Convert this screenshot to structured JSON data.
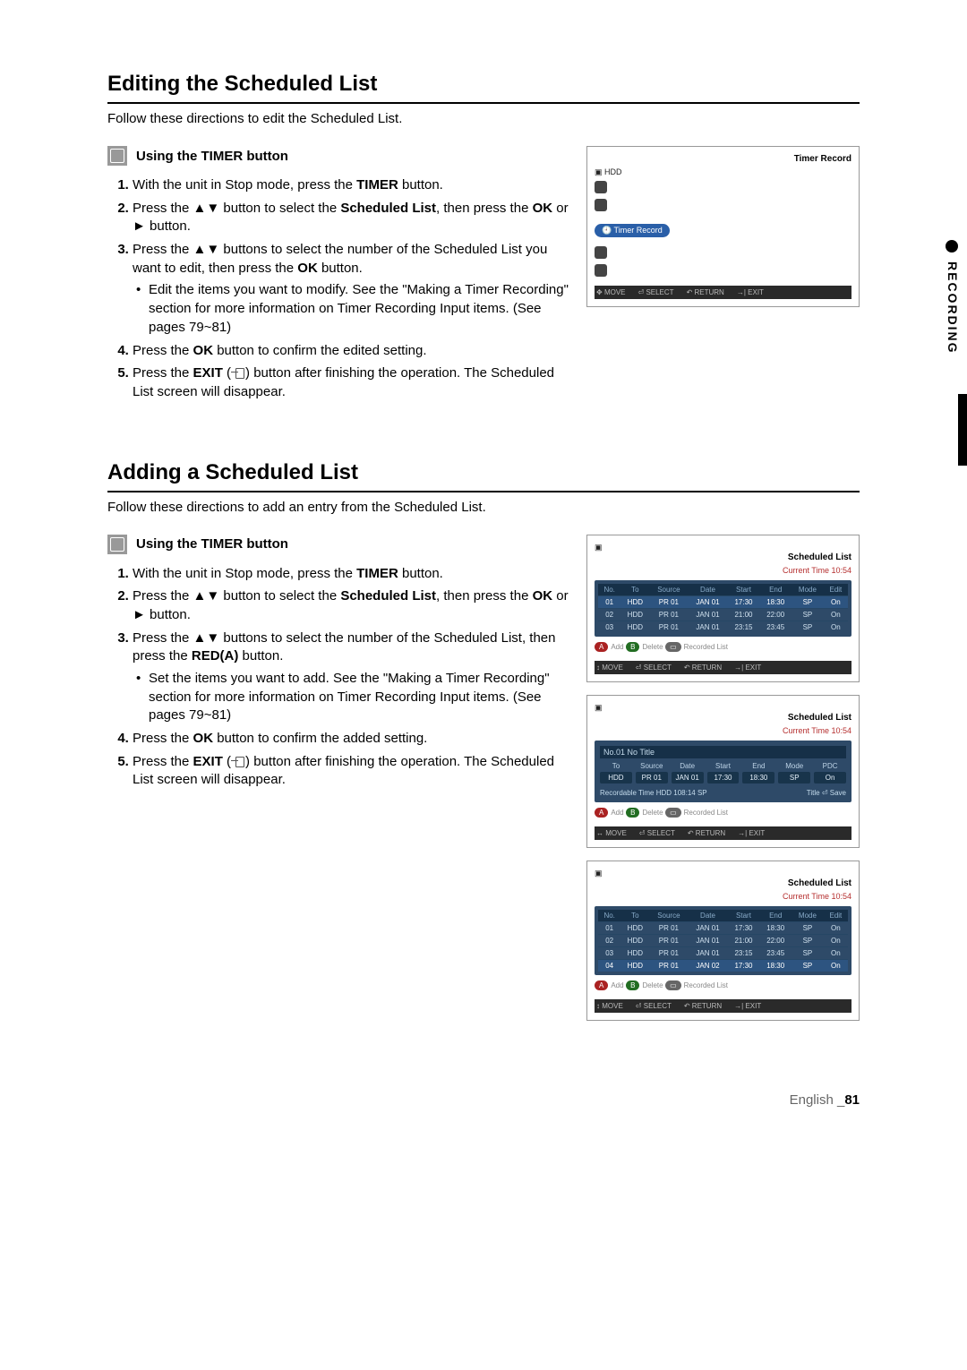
{
  "sidebar": {
    "label": "RECORDING"
  },
  "footer": {
    "lang": "English",
    "sep": "_",
    "page": "81"
  },
  "labels": {
    "timer": "Using the TIMER button"
  },
  "sym": {
    "ud": "▲▼",
    "right": "►",
    "move": "MOVE",
    "select": "SELECT",
    "return": "RETURN",
    "exit": "EXIT",
    "ok": "OK",
    "enter": "⏎"
  },
  "sec1": {
    "title": "Editing the Scheduled List",
    "intro": "Follow these directions to edit the Scheduled List.",
    "steps": {
      "s1a": "With the unit in Stop mode, press the ",
      "s1b": "TIMER",
      "s1c": " button.",
      "s2a": "Press the ",
      "s2b": " button to select the ",
      "s2c": "Scheduled List",
      "s2d": ", then press the ",
      "s2e": "OK",
      "s2f": " or ",
      "s2g": " button.",
      "s3a": "Press the ",
      "s3b": " buttons to select the number of the Scheduled List you want to edit, then press the ",
      "s3c": "OK",
      "s3d": " button.",
      "sub1": "Edit the items you want to modify. See the \"Making a Timer Recording\" section for more information on Timer Recording Input items. (See pages 79~81)",
      "s4a": "Press the ",
      "s4b": "OK",
      "s4c": " button to confirm the edited setting.",
      "s5a": "Press the ",
      "s5b": "EXIT",
      "s5c": " button after finishing the operation. The Scheduled List screen will disappear."
    },
    "shot": {
      "title": "Timer Record",
      "hdd": "HDD",
      "pill": "Timer Record"
    }
  },
  "sec2": {
    "title": "Adding a Scheduled List",
    "intro": "Follow these directions to add an entry from the Scheduled List.",
    "steps": {
      "s1a": "With the unit in Stop mode, press the ",
      "s1b": "TIMER",
      "s1c": " button.",
      "s2a": "Press the ",
      "s2b": " button to select the ",
      "s2c": "Scheduled List",
      "s2d": ", then press the ",
      "s2e": "OK",
      "s2f": " or ",
      "s2g": " button.",
      "s3a": "Press the ",
      "s3b": " buttons to select the number of the Scheduled List, then press the ",
      "s3c": "RED(A)",
      "s3d": " button.",
      "sub1": "Set the items you want to add. See the \"Making a Timer Recording\" section for more information on Timer Recording Input items. (See pages 79~81)",
      "s4a": "Press the ",
      "s4b": "OK",
      "s4c": " button to confirm the added setting.",
      "s5a": "Press the ",
      "s5b": "EXIT",
      "s5c": " button after finishing the operation. The Scheduled List screen will disappear."
    },
    "shotA": {
      "title": "Scheduled List",
      "time": "Current Time 10:54",
      "headers": [
        "No.",
        "To",
        "Source",
        "Date",
        "Start",
        "End",
        "Mode",
        "Edit"
      ],
      "rows": [
        [
          "01",
          "HDD",
          "PR 01",
          "JAN 01",
          "17:30",
          "18:30",
          "SP",
          "On"
        ],
        [
          "02",
          "HDD",
          "PR 01",
          "JAN 01",
          "21:00",
          "22:00",
          "SP",
          "On"
        ],
        [
          "03",
          "HDD",
          "PR 01",
          "JAN 01",
          "23:15",
          "23:45",
          "SP",
          "On"
        ]
      ],
      "legend": {
        "a": "Add",
        "b": "Delete",
        "e": "Recorded List"
      }
    },
    "shotB": {
      "title": "Scheduled List",
      "time": "Current Time 10:54",
      "edit_title": "No.01 No Title",
      "fields": [
        "To",
        "Source",
        "Date",
        "Start",
        "End",
        "Mode",
        "PDC"
      ],
      "values": [
        "HDD",
        "PR 01",
        "JAN 01",
        "17:30",
        "18:30",
        "SP",
        "On"
      ],
      "rec_line_left": "Recordable Time HDD 108:14 SP",
      "rec_line_right": "Title   ⏎ Save",
      "legend": {
        "a": "Add",
        "b": "Delete",
        "e": "Recorded List"
      }
    },
    "shotC": {
      "title": "Scheduled List",
      "time": "Current Time 10:54",
      "headers": [
        "No.",
        "To",
        "Source",
        "Date",
        "Start",
        "End",
        "Mode",
        "Edit"
      ],
      "rows": [
        [
          "01",
          "HDD",
          "PR 01",
          "JAN 01",
          "17:30",
          "18:30",
          "SP",
          "On"
        ],
        [
          "02",
          "HDD",
          "PR 01",
          "JAN 01",
          "21:00",
          "22:00",
          "SP",
          "On"
        ],
        [
          "03",
          "HDD",
          "PR 01",
          "JAN 01",
          "23:15",
          "23:45",
          "SP",
          "On"
        ],
        [
          "04",
          "HDD",
          "PR 01",
          "JAN 02",
          "17:30",
          "18:30",
          "SP",
          "On"
        ]
      ],
      "legend": {
        "a": "Add",
        "b": "Delete",
        "e": "Recorded List"
      }
    }
  }
}
